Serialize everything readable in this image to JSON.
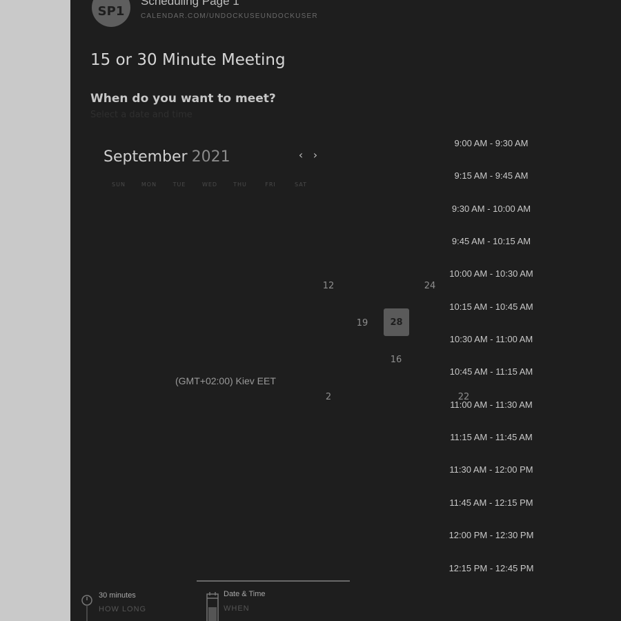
{
  "header": {
    "avatar_initials": "SP1",
    "page_name": "Scheduling Page 1",
    "url": "CALENDAR.COM/UNDOCKUSEUNDOCKUSER"
  },
  "meeting": {
    "title": "15 or 30 Minute Meeting",
    "question": "When do you want to meet?",
    "subtext": "Select a date and time"
  },
  "calendar": {
    "month": "September",
    "year": "2021",
    "prev_label": "‹",
    "next_label": "›",
    "weekdays": [
      "SUN",
      "MON",
      "TUE",
      "WED",
      "THU",
      "FRI",
      "SAT"
    ],
    "visible_days": [
      "12",
      "24",
      "19",
      "16",
      "2",
      "22"
    ],
    "selected_day": "28"
  },
  "timezone": "(GMT+02:00) Kiev EET",
  "time_slots": [
    "9:00 AM - 9:30 AM",
    "9:15 AM - 9:45 AM",
    "9:30 AM - 10:00 AM",
    "9:45 AM - 10:15 AM",
    "10:00 AM - 10:30 AM",
    "10:15 AM - 10:45 AM",
    "10:30 AM - 11:00 AM",
    "10:45 AM - 11:15 AM",
    "11:00 AM - 11:30 AM",
    "11:15 AM - 11:45 AM",
    "11:30 AM - 12:00 PM",
    "11:45 AM - 12:15 PM",
    "12:00 PM - 12:30 PM",
    "12:15 PM - 12:45 PM"
  ],
  "footer": {
    "duration_label": "30 minutes",
    "duration_sub": "HOW LONG",
    "datetime_label": "Date & Time",
    "datetime_sub": "WHEN"
  },
  "colors": {
    "background": "#1e1e1e",
    "selected_day_bg": "#5a5a5a",
    "outer_bg": "#c9c9c9"
  }
}
